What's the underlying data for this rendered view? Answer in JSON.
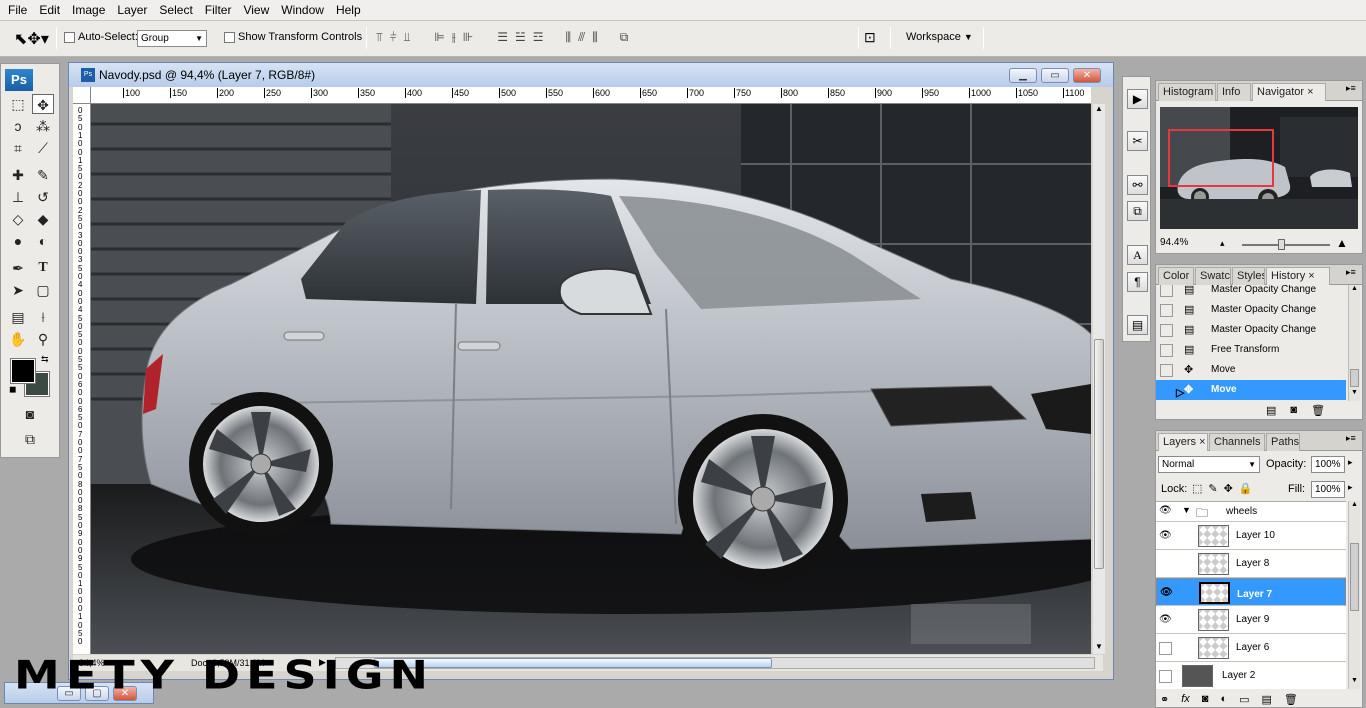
{
  "menu": [
    "File",
    "Edit",
    "Image",
    "Layer",
    "Select",
    "Filter",
    "View",
    "Window",
    "Help"
  ],
  "options": {
    "auto_select_label": "Auto-Select:",
    "auto_select_value": "Group",
    "show_transform_label": "Show Transform Controls",
    "workspace_label": "Workspace"
  },
  "toolbox": {
    "logo": "Ps"
  },
  "document": {
    "title": "Navody.psd @ 94,4% (Layer 7, RGB/8#)",
    "zoom_status": "94,4%",
    "doc_status": "Doc: 6,59M/31,0M",
    "ruler_top": [
      "100",
      "150",
      "200",
      "250",
      "300",
      "350",
      "400",
      "450",
      "500",
      "550",
      "600",
      "650",
      "700",
      "750",
      "800",
      "850",
      "900",
      "950",
      "1000",
      "1050",
      "1100"
    ],
    "ruler_left": [
      "0",
      "5",
      "0",
      "1",
      "0",
      "0",
      "1",
      "5",
      "0",
      "2",
      "0",
      "0",
      "2",
      "5",
      "0",
      "3",
      "0",
      "0",
      "3",
      "5",
      "0",
      "4",
      "0",
      "0",
      "4",
      "5",
      "0",
      "5",
      "0",
      "0",
      "5",
      "5",
      "0",
      "6",
      "0",
      "0",
      "6",
      "5",
      "0",
      "7",
      "0",
      "0",
      "7",
      "5",
      "0",
      "8",
      "0",
      "0",
      "8",
      "5",
      "0",
      "9",
      "0",
      "0",
      "9",
      "5",
      "0",
      "1",
      "0",
      "0",
      "0",
      "1",
      "0",
      "5",
      "0"
    ]
  },
  "navigator": {
    "tabs": [
      "Histogram",
      "Info",
      "Navigator"
    ],
    "zoom": "94.4%"
  },
  "history": {
    "tabs": [
      "Color",
      "Swatc",
      "Styles",
      "History"
    ],
    "items": [
      {
        "label": "Master Opacity Change",
        "icon": "history-doc-icon"
      },
      {
        "label": "Master Opacity Change",
        "icon": "history-doc-icon"
      },
      {
        "label": "Master Opacity Change",
        "icon": "history-doc-icon"
      },
      {
        "label": "Free Transform",
        "icon": "history-doc-icon"
      },
      {
        "label": "Move",
        "icon": "move-tool-icon"
      },
      {
        "label": "Move",
        "icon": "move-tool-icon"
      }
    ]
  },
  "layers": {
    "tabs": [
      "Layers",
      "Channels",
      "Paths"
    ],
    "blend_mode": "Normal",
    "opacity_label": "Opacity:",
    "opacity_value": "100%",
    "lock_label": "Lock:",
    "fill_label": "Fill:",
    "fill_value": "100%",
    "group_name": "wheels",
    "items": [
      {
        "name": "Layer 10",
        "visible": true
      },
      {
        "name": "Layer 8",
        "visible": false
      },
      {
        "name": "Layer 7",
        "visible": true,
        "selected": true
      },
      {
        "name": "Layer 9",
        "visible": true
      },
      {
        "name": "Layer 6",
        "visible": false
      },
      {
        "name": "Layer 2",
        "visible": false
      }
    ]
  },
  "watermark": "METY DESIGN",
  "colors": {
    "selection": "#3399ff",
    "foreground": "#000000",
    "background": "#3c4a44",
    "navigator_frame": "#e8383d"
  }
}
